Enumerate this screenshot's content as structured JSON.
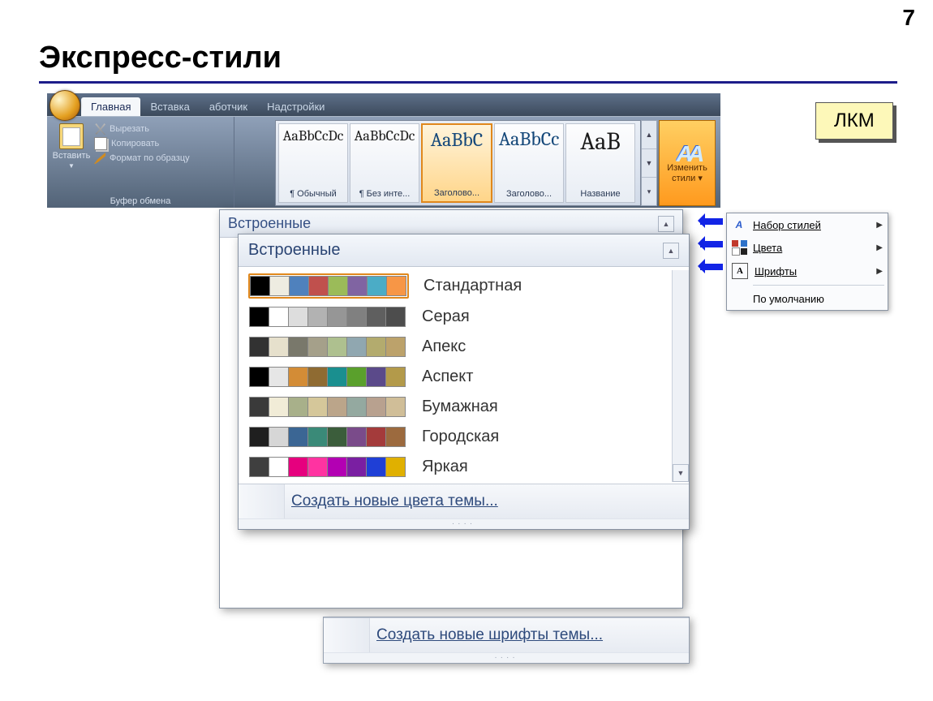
{
  "slide": {
    "title": "Экспресс-стили",
    "page_number": "7"
  },
  "ribbon": {
    "tabs": [
      "Главная",
      "Вставка",
      "аботчик",
      "Надстройки"
    ],
    "clipboard": {
      "paste": "Вставить",
      "cut": "Вырезать",
      "copy": "Копировать",
      "format_painter": "Формат по образцу",
      "group_label": "Буфер обмена"
    },
    "styles": [
      {
        "sample": "AaBbCcDc",
        "label": "¶ Обычный"
      },
      {
        "sample": "AaBbCcDc",
        "label": "¶ Без инте..."
      },
      {
        "sample": "AaBbC",
        "label": "Заголово..."
      },
      {
        "sample": "AaBbCc",
        "label": "Заголово..."
      },
      {
        "sample": "AaB",
        "label": "Название"
      }
    ],
    "change_styles": {
      "line1": "Изменить",
      "line2": "стили ▾"
    }
  },
  "callout": {
    "text": "ЛКМ"
  },
  "cs_menu": {
    "items": [
      {
        "id": "style-set",
        "label": "Набор стилей",
        "arrow": true
      },
      {
        "id": "colors",
        "label": "Цвета",
        "arrow": true
      },
      {
        "id": "fonts",
        "label": "Шрифты",
        "arrow": true
      }
    ],
    "default": "По умолчанию"
  },
  "back_popup": {
    "header": "Встроенные"
  },
  "colors_popup": {
    "header": "Встроенные",
    "schemes": [
      {
        "name": "Стандартная",
        "selected": true,
        "colors": [
          "#000000",
          "#eeece1",
          "#4f81bd",
          "#c0504d",
          "#9bbb59",
          "#8064a2",
          "#4bacc6",
          "#f79646"
        ]
      },
      {
        "name": "Серая",
        "colors": [
          "#000000",
          "#ffffff",
          "#dddddd",
          "#b2b2b2",
          "#969696",
          "#808080",
          "#5f5f5f",
          "#4d4d4d"
        ]
      },
      {
        "name": "Апекс",
        "colors": [
          "#323232",
          "#e6e0cc",
          "#79786b",
          "#a5a08a",
          "#aec08f",
          "#90a7b0",
          "#b3ab6e",
          "#bca26b"
        ]
      },
      {
        "name": "Аспект",
        "colors": [
          "#000000",
          "#e6e6e6",
          "#d38c36",
          "#8f6b32",
          "#1a8f8f",
          "#5aa02c",
          "#5b4a8a",
          "#b39a4a"
        ]
      },
      {
        "name": "Бумажная",
        "colors": [
          "#3a3a3a",
          "#f1ecd7",
          "#a8b08a",
          "#d5c79a",
          "#bba58a",
          "#94a9a0",
          "#b8a18f",
          "#d0be98"
        ]
      },
      {
        "name": "Городская",
        "colors": [
          "#1f1f1f",
          "#d6d6d6",
          "#3b6694",
          "#3a8a78",
          "#3b5d3b",
          "#7a4b8a",
          "#a43b3b",
          "#9c6a3e"
        ]
      },
      {
        "name": "Яркая",
        "colors": [
          "#3f3f3f",
          "#ffffff",
          "#e6007e",
          "#ff33a1",
          "#b300b3",
          "#7a1fa2",
          "#1f3fd6",
          "#e0b000"
        ]
      }
    ],
    "create_colors": "Создать новые цвета темы..."
  },
  "fonts_popup": {
    "create_fonts": "Создать новые шрифты темы..."
  }
}
